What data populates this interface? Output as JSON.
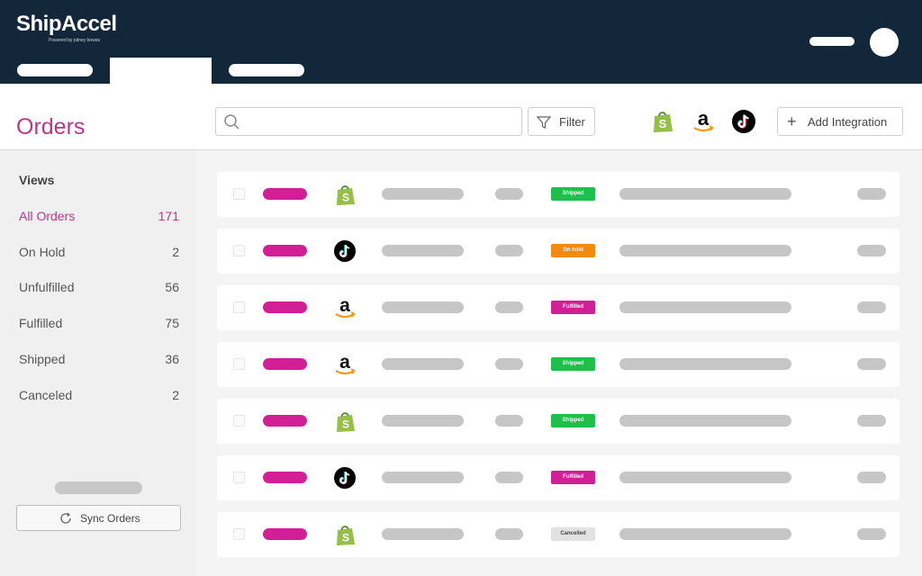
{
  "app": {
    "name": "ShipAccel",
    "tagline": "Powered by pitney bowes"
  },
  "page": {
    "title": "Orders"
  },
  "toolbar": {
    "search_placeholder": "",
    "filter_label": "Filter",
    "add_integration_label": "Add Integration",
    "integrations": [
      "shopify",
      "amazon",
      "tiktok"
    ]
  },
  "sidebar": {
    "heading": "Views",
    "items": [
      {
        "label": "All Orders",
        "count": "171",
        "active": true
      },
      {
        "label": "On Hold",
        "count": "2"
      },
      {
        "label": "Unfulfilled",
        "count": "56"
      },
      {
        "label": "Fulfilled",
        "count": "75"
      },
      {
        "label": "Shipped",
        "count": "36"
      },
      {
        "label": "Canceled",
        "count": "2"
      }
    ],
    "sync_label": "Sync Orders"
  },
  "colors": {
    "header_bg": "#12283a",
    "accent": "#c2338b",
    "order_pill": "#d21f96",
    "shipped": "#1fbf4c",
    "on_hold": "#f28a12",
    "fulfilled": "#d21f96",
    "cancelled_bg": "#e2e2e2"
  },
  "orders": [
    {
      "channel": "shopify",
      "status": "Shipped",
      "status_color": "#1fbf4c"
    },
    {
      "channel": "tiktok",
      "status": "On hold",
      "status_color": "#f28a12"
    },
    {
      "channel": "amazon",
      "status": "Fulfilled",
      "status_color": "#d21f96"
    },
    {
      "channel": "amazon",
      "status": "Shipped",
      "status_color": "#1fbf4c"
    },
    {
      "channel": "shopify",
      "status": "Shipped",
      "status_color": "#1fbf4c"
    },
    {
      "channel": "tiktok",
      "status": "Fulfilled",
      "status_color": "#d21f96"
    },
    {
      "channel": "shopify",
      "status": "Cancelled",
      "status_color": "#e2e2e2"
    }
  ]
}
